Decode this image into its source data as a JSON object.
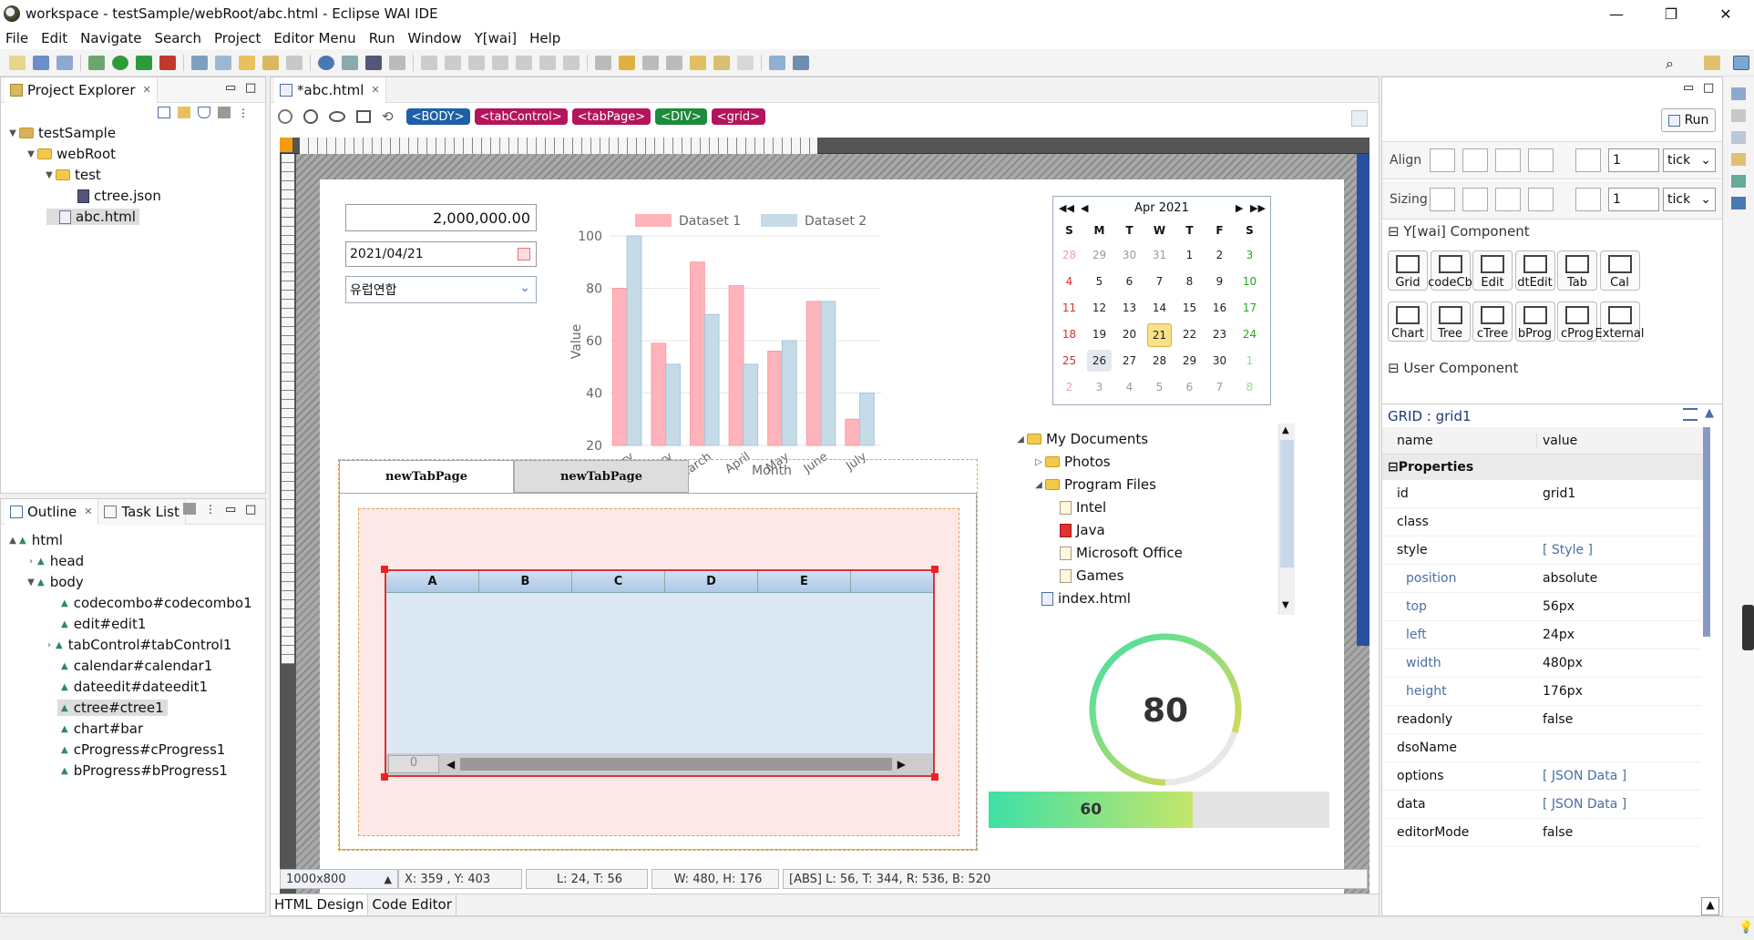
{
  "window": {
    "title": "workspace - testSample/webRoot/abc.html - Eclipse WAI IDE"
  },
  "menu": [
    "File",
    "Edit",
    "Navigate",
    "Search",
    "Project",
    "Editor Menu",
    "Run",
    "Window",
    "Y[wai]",
    "Help"
  ],
  "project_explorer": {
    "title": "Project Explorer",
    "items": [
      {
        "label": "testSample"
      },
      {
        "label": "webRoot"
      },
      {
        "label": "test"
      },
      {
        "label": "ctree.json"
      },
      {
        "label": "abc.html"
      }
    ]
  },
  "outline": {
    "tab_outline": "Outline",
    "tab_tasks": "Task List",
    "items": [
      "html",
      "head",
      "body",
      "codecombo#codecombo1",
      "edit#edit1",
      "tabControl#tabControl1",
      "calendar#calendar1",
      "dateedit#dateedit1",
      "ctree#ctree1",
      "chart#bar",
      "cProgress#cProgress1",
      "bProgress#bProgress1"
    ]
  },
  "editor": {
    "tab": "*abc.html",
    "breadcrumbs": [
      {
        "label": "<BODY>",
        "color": "#1f5fa8"
      },
      {
        "label": "<tabControl>",
        "color": "#b3145b"
      },
      {
        "label": "<tabPage>",
        "color": "#b3145b"
      },
      {
        "label": "<DIV>",
        "color": "#1e8a3c"
      },
      {
        "label": "<grid>",
        "color": "#b3145b"
      }
    ],
    "bottom_tabs": [
      "HTML Design",
      "Code Editor"
    ],
    "status": {
      "size": "1000x800",
      "xy": "X: 359 , Y: 403",
      "lt": "L: 24, T: 56",
      "wh": "W: 480, H: 176",
      "abs": "[ABS] L: 56, T: 344, R: 536, B: 520"
    }
  },
  "design": {
    "edit_value": "2,000,000.00",
    "date_value": "2021/04/21",
    "combo_value": "유럽연합",
    "tab_pages": [
      "newTabPage",
      "newTabPage"
    ],
    "grid": {
      "columns": [
        "A",
        "B",
        "C",
        "D",
        "E"
      ],
      "scroll_value": "0"
    },
    "calendar": {
      "month": "Apr 2021",
      "weekdays": [
        "S",
        "M",
        "T",
        "W",
        "T",
        "F",
        "S"
      ],
      "weeks": [
        [
          "28",
          "29",
          "30",
          "31",
          "1",
          "2",
          "3"
        ],
        [
          "4",
          "5",
          "6",
          "7",
          "8",
          "9",
          "10"
        ],
        [
          "11",
          "12",
          "13",
          "14",
          "15",
          "16",
          "17"
        ],
        [
          "18",
          "19",
          "20",
          "21",
          "22",
          "23",
          "24"
        ],
        [
          "25",
          "26",
          "27",
          "28",
          "29",
          "30",
          "1"
        ],
        [
          "2",
          "3",
          "4",
          "5",
          "6",
          "7",
          "8"
        ]
      ],
      "selected": "21"
    },
    "tree": [
      "My Documents",
      "Photos",
      "Program Files",
      "Intel",
      "Java",
      "Microsoft Office",
      "Games",
      "index.html"
    ],
    "circle_progress": "80",
    "bar_progress": "60",
    "circle_progress_fraction": 0.8,
    "bar_progress_fraction": 0.6
  },
  "chart_data": {
    "type": "bar",
    "categories": [
      "January",
      "February",
      "March",
      "April",
      "May",
      "June",
      "July"
    ],
    "series": [
      {
        "name": "Dataset 1",
        "values": [
          80,
          59,
          90,
          81,
          56,
          75,
          30
        ],
        "color": "#ffb3ba"
      },
      {
        "name": "Dataset 2",
        "values": [
          100,
          51,
          70,
          51,
          60,
          75,
          40
        ],
        "color": "#c5dbe8"
      }
    ],
    "xlabel": "Month",
    "ylabel": "Value",
    "yticks": [
      "100",
      "80",
      "60",
      "40",
      "20"
    ],
    "ylim": [
      20,
      100
    ],
    "legend": "top"
  },
  "right_panel": {
    "run_label": "Run",
    "align_label": "Align",
    "sizing_label": "Sizing",
    "align_value": "1",
    "align_unit": "tick",
    "sizing_value": "1",
    "sizing_unit": "tick",
    "ywai_title": "Y[wai] Component",
    "palette": [
      "Grid",
      "codeCb",
      "Edit",
      "dtEdit",
      "Tab",
      "Cal",
      "Chart",
      "Tree",
      "cTree",
      "bProg",
      "cProg",
      "External"
    ],
    "user_title": "User Component",
    "props_title": "GRID : grid1",
    "col_name": "name",
    "col_value": "value",
    "section": "Properties",
    "props": [
      {
        "n": "id",
        "v": "grid1"
      },
      {
        "n": "class",
        "v": ""
      },
      {
        "n": "style",
        "v": "[ Style ]"
      },
      {
        "n": "position",
        "v": "absolute"
      },
      {
        "n": "top",
        "v": "56px"
      },
      {
        "n": "left",
        "v": "24px"
      },
      {
        "n": "width",
        "v": "480px"
      },
      {
        "n": "height",
        "v": "176px"
      },
      {
        "n": "readonly",
        "v": "false"
      },
      {
        "n": "dsoName",
        "v": ""
      },
      {
        "n": "options",
        "v": "[ JSON Data ]"
      },
      {
        "n": "data",
        "v": "[ JSON Data ]"
      },
      {
        "n": "editorMode",
        "v": "false"
      }
    ]
  }
}
